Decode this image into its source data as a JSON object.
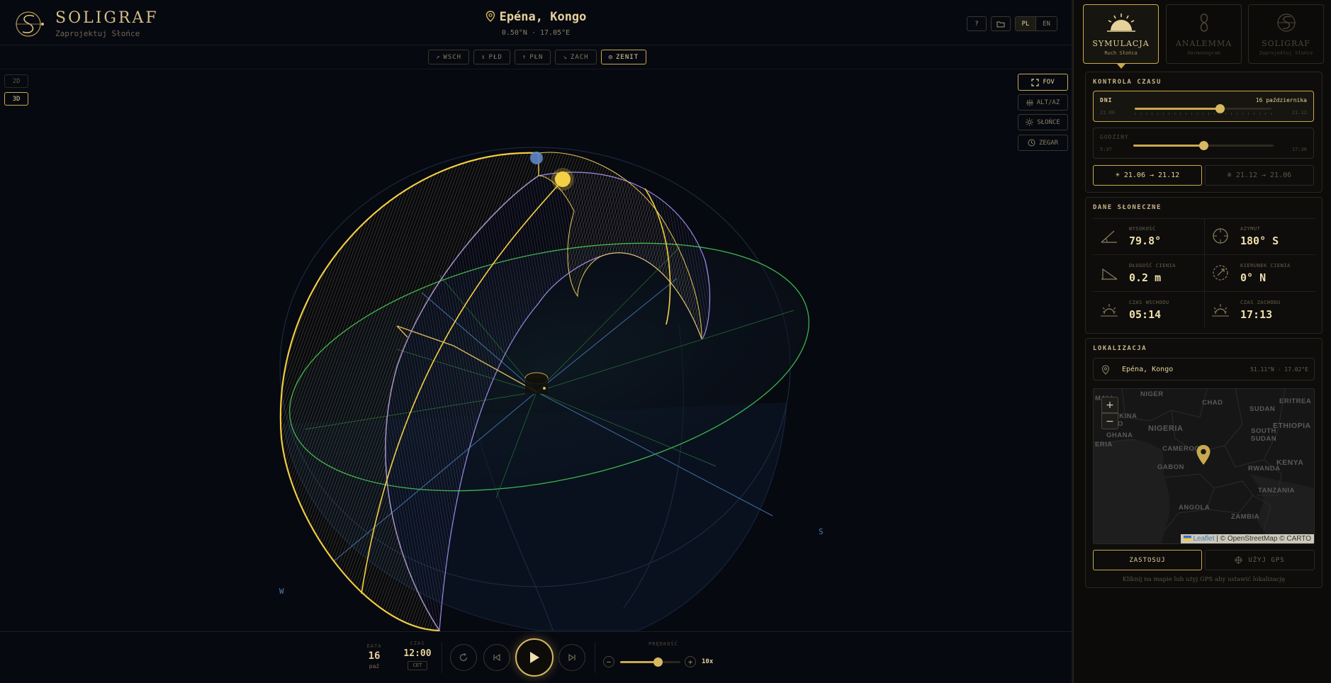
{
  "app": {
    "name": "SOLIGRAF",
    "tagline": "Zaprojektuj Słońce"
  },
  "header": {
    "location": "Epéna, Kongo",
    "coords": "0.50°N · 17.05°E",
    "help_label": "?",
    "languages": [
      "PL",
      "EN"
    ],
    "active_language": "PL"
  },
  "view_toolbar": [
    {
      "label": "WSCH",
      "glyph": "↗",
      "active": false
    },
    {
      "label": "PŁD",
      "glyph": "↕",
      "active": false
    },
    {
      "label": "PŁN",
      "glyph": "↑",
      "active": false
    },
    {
      "label": "ZACH",
      "glyph": "↘",
      "active": false
    },
    {
      "label": "ZENIT",
      "glyph": "◎",
      "active": true
    }
  ],
  "dimension": {
    "d2": "2D",
    "d3": "3D",
    "active": "3D"
  },
  "overlay_buttons": {
    "fov": "FOV",
    "altaz": "ALT/AZ",
    "sun": "SŁOŃCE",
    "clock": "ZEGAR"
  },
  "compass": {
    "west": "W",
    "south": "S"
  },
  "playback": {
    "date_caption": "DATA",
    "date_day": "16",
    "date_month": "paź",
    "time_caption": "CZAS",
    "time_value": "12:00",
    "timezone": "CET",
    "speed_caption": "PRĘDKOŚĆ",
    "speed_value": "10x",
    "speed_fraction": 0.62
  },
  "modes": [
    {
      "name": "SYMULACJA",
      "sub": "Ruch Słońca",
      "active": true
    },
    {
      "name": "ANALEMMA",
      "sub": "Harmonogram",
      "active": false
    },
    {
      "name": "SOLIGRAF",
      "sub": "Zaprojektuj Słońce",
      "active": false
    }
  ],
  "time_control": {
    "title": "KONTROLA CZASU",
    "days": {
      "label": "DNI",
      "current": "16 października",
      "min": "21.06",
      "max": "21.12",
      "fraction": 0.62
    },
    "hours": {
      "label": "GODZINY",
      "min": "5:37",
      "max": "17:36",
      "fraction": 0.5
    },
    "season_a": "21.06 → 21.12",
    "season_b": "21.12 → 21.06"
  },
  "sun_data": {
    "title": "DANE SŁONECZNE",
    "altitude": {
      "label": "WYSOKOŚĆ",
      "value": "79.8°"
    },
    "azimuth": {
      "label": "AZYMUT",
      "value": "180° S"
    },
    "shadow_length": {
      "label": "DŁUGOŚĆ CIENIA",
      "value": "0.2 m"
    },
    "shadow_direction": {
      "label": "KIERUNEK CIENIA",
      "value": "0° N"
    },
    "sunrise": {
      "label": "CZAS WSCHODU",
      "value": "05:14"
    },
    "sunset": {
      "label": "CZAS ZACHODU",
      "value": "17:13"
    }
  },
  "location": {
    "title": "LOKALIZACJA",
    "name": "Epéna, Kongo",
    "coords": "51.11°N · 17.02°E",
    "map_labels": [
      "MALI",
      "NIGER",
      "CHAD",
      "ERITREA",
      "BURKINA FASO",
      "NIGERIA",
      "SUDAN",
      "ETHIOPIA",
      "GHANA",
      "SOUTH SUDAN",
      "ERIA",
      "CAMEROON",
      "GABON",
      "KENYA",
      "RWANDA",
      "TANZANIA",
      "ANGOLA",
      "ZAMBIA"
    ],
    "attribution_leaflet": "Leaflet",
    "attribution_rest": " | © OpenStreetMap © CARTO",
    "apply_label": "ZASTOSUJ",
    "gps_label": "UŻYJ GPS",
    "hint": "Kliknij na mapie lub użyj GPS aby ustawić lokalizację"
  },
  "colors": {
    "accent": "#d8b860",
    "sun": "#f5d044",
    "horizon": "#3bb54a",
    "sky_lines": "#4a7fc0",
    "dome_violet": "#8a7ad8"
  }
}
